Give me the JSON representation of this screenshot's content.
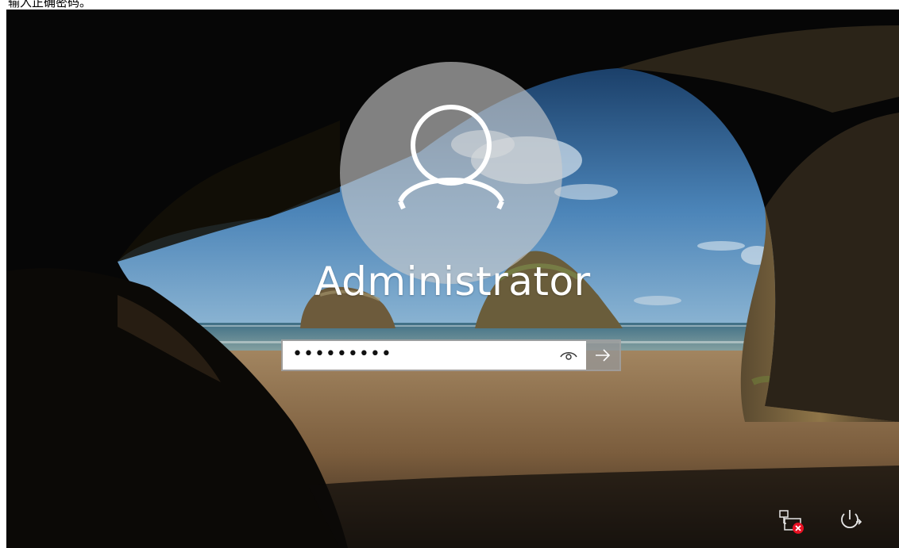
{
  "caption": "输入正确密码。",
  "login": {
    "username": "Administrator",
    "password_mask": "•••••••••"
  },
  "icons": {
    "avatar": "user-avatar-icon",
    "reveal": "eye-icon",
    "submit": "arrow-right-icon",
    "network": "network-disconnected-icon",
    "power": "power-icon"
  },
  "colors": {
    "sky": "#3a6f9e",
    "sand": "#8a6a44",
    "rock": "#1a140e",
    "field": "#ffffff",
    "submit": "#969696"
  }
}
